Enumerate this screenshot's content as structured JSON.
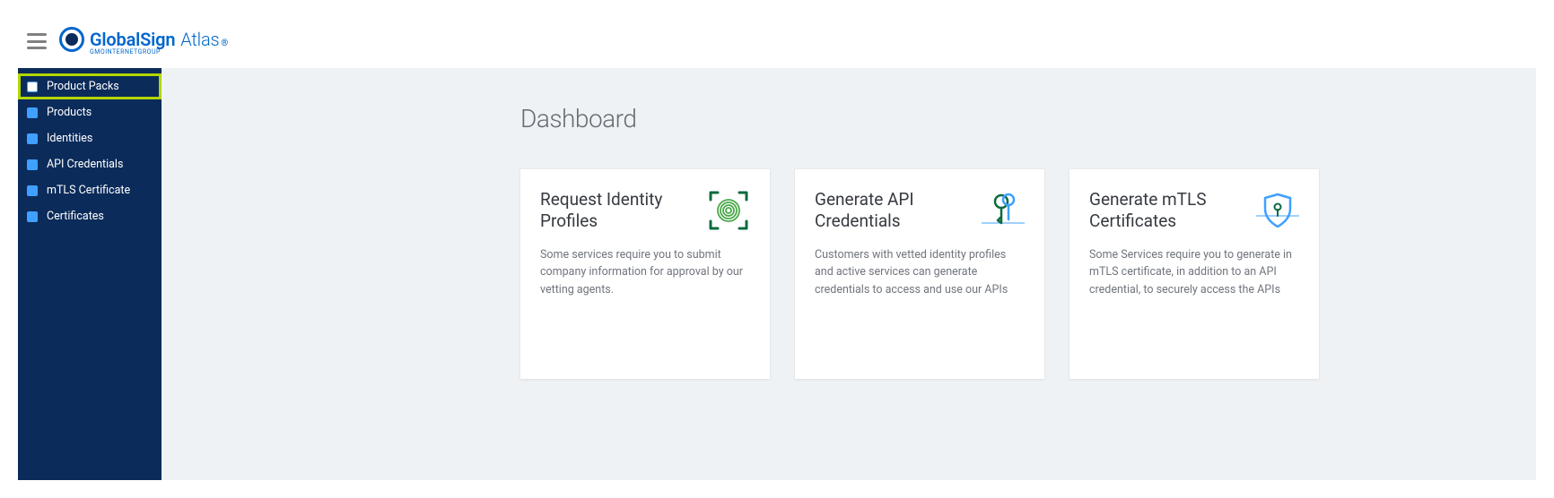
{
  "logo": {
    "brand": "GlobalSign",
    "product": "Atlas",
    "sub": "GMOINTERNETGROUP"
  },
  "sidebar": {
    "items": [
      {
        "label": "Product Packs",
        "key": "product-packs",
        "highlighted": true
      },
      {
        "label": "Products",
        "key": "products"
      },
      {
        "label": "Identities",
        "key": "identities"
      },
      {
        "label": "API Credentials",
        "key": "api-credentials"
      },
      {
        "label": "mTLS Certificate",
        "key": "mtls-certificate"
      },
      {
        "label": "Certificates",
        "key": "certificates"
      }
    ]
  },
  "main": {
    "title": "Dashboard",
    "cards": [
      {
        "title": "Request Identity Profiles",
        "desc": "Some services require you to submit company information for approval by our vetting agents.",
        "icon": "fingerprint-icon"
      },
      {
        "title": "Generate API Credentials",
        "desc": "Customers with vetted identity profiles and active services can generate credentials to access and use our APIs",
        "icon": "keys-icon"
      },
      {
        "title": "Generate mTLS Certificates",
        "desc": "Some Services require you to generate in mTLS certificate, in addition to an API credential, to securely access the APIs",
        "icon": "shield-icon"
      }
    ]
  }
}
